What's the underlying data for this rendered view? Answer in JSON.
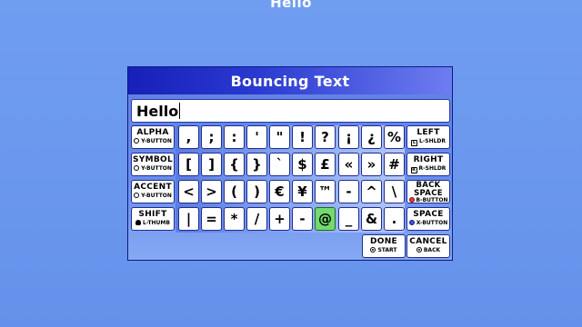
{
  "preview": "Hello",
  "dialog": {
    "title": "Bouncing Text",
    "input_value": "Hello"
  },
  "colors": {
    "background": "#6b98ee",
    "title_bar": "#1720b8",
    "active_key": "#74d96e"
  },
  "keys": {
    "row1": [
      ",",
      ";",
      ":",
      "'",
      "\"",
      "!",
      "?",
      "¡",
      "¿",
      "%"
    ],
    "row2": [
      "[",
      "]",
      "{",
      "}",
      "`",
      "$",
      "£",
      "«",
      "»",
      "#"
    ],
    "row3": [
      "<",
      ">",
      "(",
      ")",
      "€",
      "¥",
      "™",
      "-",
      "^",
      "\\"
    ],
    "row4": [
      "|",
      "=",
      "*",
      "/",
      "+",
      "-",
      "@",
      "_",
      "&",
      "."
    ],
    "active": "@"
  },
  "left_buttons": [
    {
      "label": "ALPHA",
      "hint": "Y-BUTTON",
      "icon": "y-button-icon"
    },
    {
      "label": "SYMBOL",
      "hint": "Y-BUTTON",
      "icon": "y-button-icon"
    },
    {
      "label": "ACCENT",
      "hint": "Y-BUTTON",
      "icon": "y-button-icon"
    },
    {
      "label": "SHIFT",
      "hint": "L-THUMB",
      "icon": "l-thumb-icon"
    }
  ],
  "right_buttons": [
    {
      "label": "LEFT",
      "hint": "L-SHLDR",
      "icon": "l-shoulder-icon"
    },
    {
      "label": "RIGHT",
      "hint": "R-SHLDR",
      "icon": "r-shoulder-icon"
    },
    {
      "label": "BACK",
      "label2": "SPACE",
      "hint": "B-BUTTON",
      "icon": "b-button-icon"
    },
    {
      "label": "SPACE",
      "hint": "X-BUTTON",
      "icon": "x-button-icon"
    },
    {
      "label": "CANCEL",
      "hint": "BACK",
      "icon": "back-button-icon"
    }
  ],
  "done_button": {
    "label": "DONE",
    "hint": "START",
    "icon": "start-button-icon"
  }
}
